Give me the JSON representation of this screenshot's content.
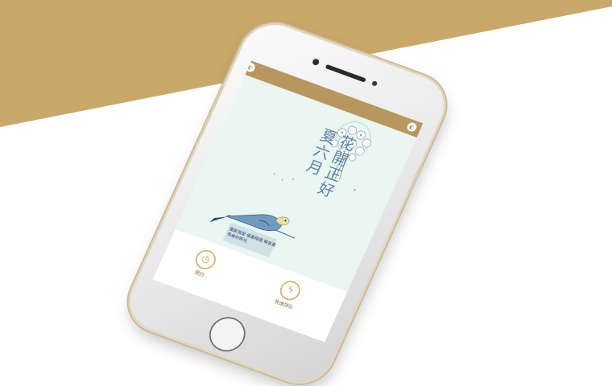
{
  "colors": {
    "gold": "#c8a86b",
    "header_gold": "#b8975f",
    "banner_bg": "#e9f6f2",
    "title_blue": "#5f83a8"
  },
  "banner": {
    "title_lines": [
      "花開正好",
      "夏六月"
    ],
    "caption": "獨家頁面 優惠精選 暢享夏季美好時光",
    "art": [
      "flower-bouquet",
      "parakeet-bird"
    ]
  },
  "bottom_nav": {
    "items": [
      {
        "label": "预约",
        "icon": "clock-icon"
      },
      {
        "label": "快速排队",
        "icon": "lightning-icon"
      }
    ]
  }
}
